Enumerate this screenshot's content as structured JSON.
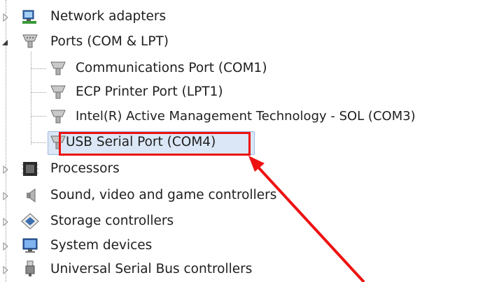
{
  "tree": {
    "network_adapters": "Network adapters",
    "ports": {
      "label": "Ports (COM & LPT)",
      "children": [
        "Communications Port (COM1)",
        "ECP Printer Port (LPT1)",
        "Intel(R) Active Management Technology - SOL (COM3)",
        "USB Serial Port (COM4)"
      ]
    },
    "processors": "Processors",
    "sound": "Sound, video and game controllers",
    "storage": "Storage controllers",
    "system": "System devices",
    "usb": "Universal Serial Bus controllers"
  },
  "icons": {
    "network": "network-adapter-icon",
    "port": "port-connector-icon",
    "processor": "processor-chip-icon",
    "sound": "speaker-icon",
    "storage": "storage-diamond-icon",
    "system": "monitor-icon",
    "usb": "usb-plug-icon"
  },
  "colors": {
    "selection_fill": "#dbe7f6",
    "selection_border": "#9cbbe3",
    "annotation": "#ee1111"
  }
}
